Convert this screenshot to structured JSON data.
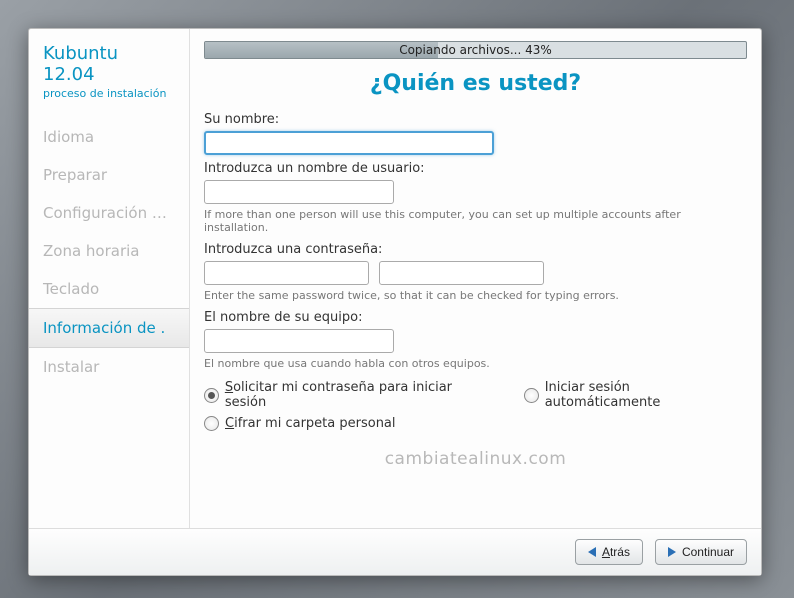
{
  "brand": {
    "title": "Kubuntu 12.04",
    "subtitle": "proceso de instalación"
  },
  "sidebar": {
    "items": [
      {
        "label": "Idioma"
      },
      {
        "label": "Preparar"
      },
      {
        "label": "Configuración d..."
      },
      {
        "label": "Zona horaria"
      },
      {
        "label": "Teclado"
      },
      {
        "label": "Información de ."
      },
      {
        "label": "Instalar"
      }
    ],
    "active_index": 5
  },
  "progress": {
    "text": "Copiando archivos... 43%",
    "percent": 43
  },
  "page": {
    "title": "¿Quién es usted?"
  },
  "form": {
    "name_label": "Su nombre:",
    "name_value": "",
    "user_label": "Introduzca un nombre de usuario:",
    "user_value": "",
    "user_hint": "If more than one person will use this computer, you can set up multiple accounts after installation.",
    "pw_label": "Introduzca una contraseña:",
    "pw1_value": "",
    "pw2_value": "",
    "pw_hint": "Enter the same password twice, so that it can be checked for typing errors.",
    "host_label": "El nombre de su equipo:",
    "host_value": "",
    "host_hint": "El nombre que usa cuando habla con otros equipos.",
    "radio_require_pw": "Solicitar mi contraseña para iniciar sesión",
    "radio_auto_login": "Iniciar sesión automáticamente",
    "check_encrypt": "Cifrar mi carpeta personal",
    "login_selection": "require_password",
    "encrypt_checked": false
  },
  "watermark": "cambiatealinux.com",
  "footer": {
    "back": "Atrás",
    "next": "Continuar"
  }
}
